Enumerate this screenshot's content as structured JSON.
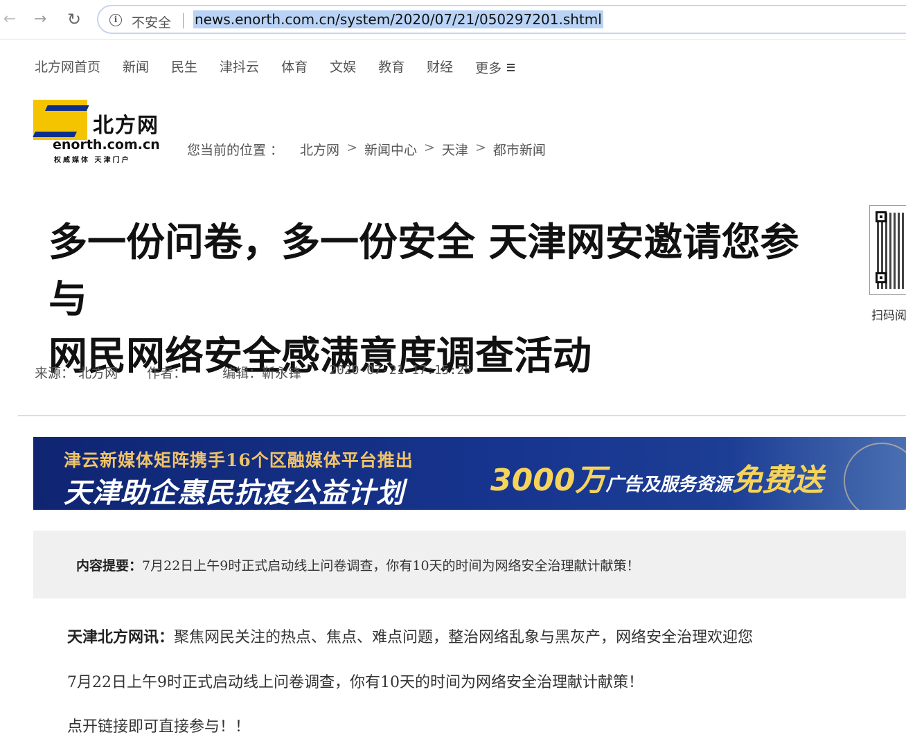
{
  "browser": {
    "security_label": "不安全",
    "url": "news.enorth.com.cn/system/2020/07/21/050297201.shtml"
  },
  "topnav": {
    "items": [
      "北方网首页",
      "新闻",
      "民生",
      "津抖云",
      "体育",
      "文娱",
      "教育",
      "财经"
    ],
    "more_label": "更多"
  },
  "logo": {
    "name_cn": "北方网",
    "domain": "enorth.com.cn",
    "tagline": "权威媒体 天津门户"
  },
  "breadcrumb": {
    "label": "您当前的位置 ：",
    "items": [
      "北方网",
      "新闻中心",
      "天津",
      "都市新闻"
    ]
  },
  "article": {
    "title_line1": "多一份问卷，多一份安全 天津网安邀请您参与",
    "title_line2": "网民网络安全感满意度调查活动",
    "source_label": "来源：",
    "source": "北方网",
    "author_label": "作者：",
    "author": "",
    "editor_label": "编辑：",
    "editor": "靳永锋",
    "datetime": "2020-07-21 17:15:25"
  },
  "qr": {
    "label": "扫码阅读"
  },
  "banner": {
    "line1": "津云新媒体矩阵携手16个区融媒体平台推出",
    "line2": "天津助企惠民抗疫公益计划",
    "right_amount": "3000万",
    "right_mid": "广告及服务资源",
    "right_end": "免费送"
  },
  "summary": {
    "label": "内容提要：",
    "text": "7月22日上午9时正式启动线上问卷调查，你有10天的时间为网络安全治理献计献策！"
  },
  "body": {
    "p1_lead": "天津北方网讯：",
    "p1_text": "聚焦网民关注的热点、焦点、难点问题，整治网络乱象与黑灰产，网络安全治理欢迎您",
    "p2": "7月22日上午9时正式启动线上问卷调查，你有10天的时间为网络安全治理献计献策！",
    "p3": "点开链接即可直接参与！！"
  },
  "colors": {
    "banner_bg": "#17358f",
    "banner_gold": "#f6d45a",
    "url_highlight": "#b8d3f6",
    "summary_bg": "#f0f0f0"
  }
}
